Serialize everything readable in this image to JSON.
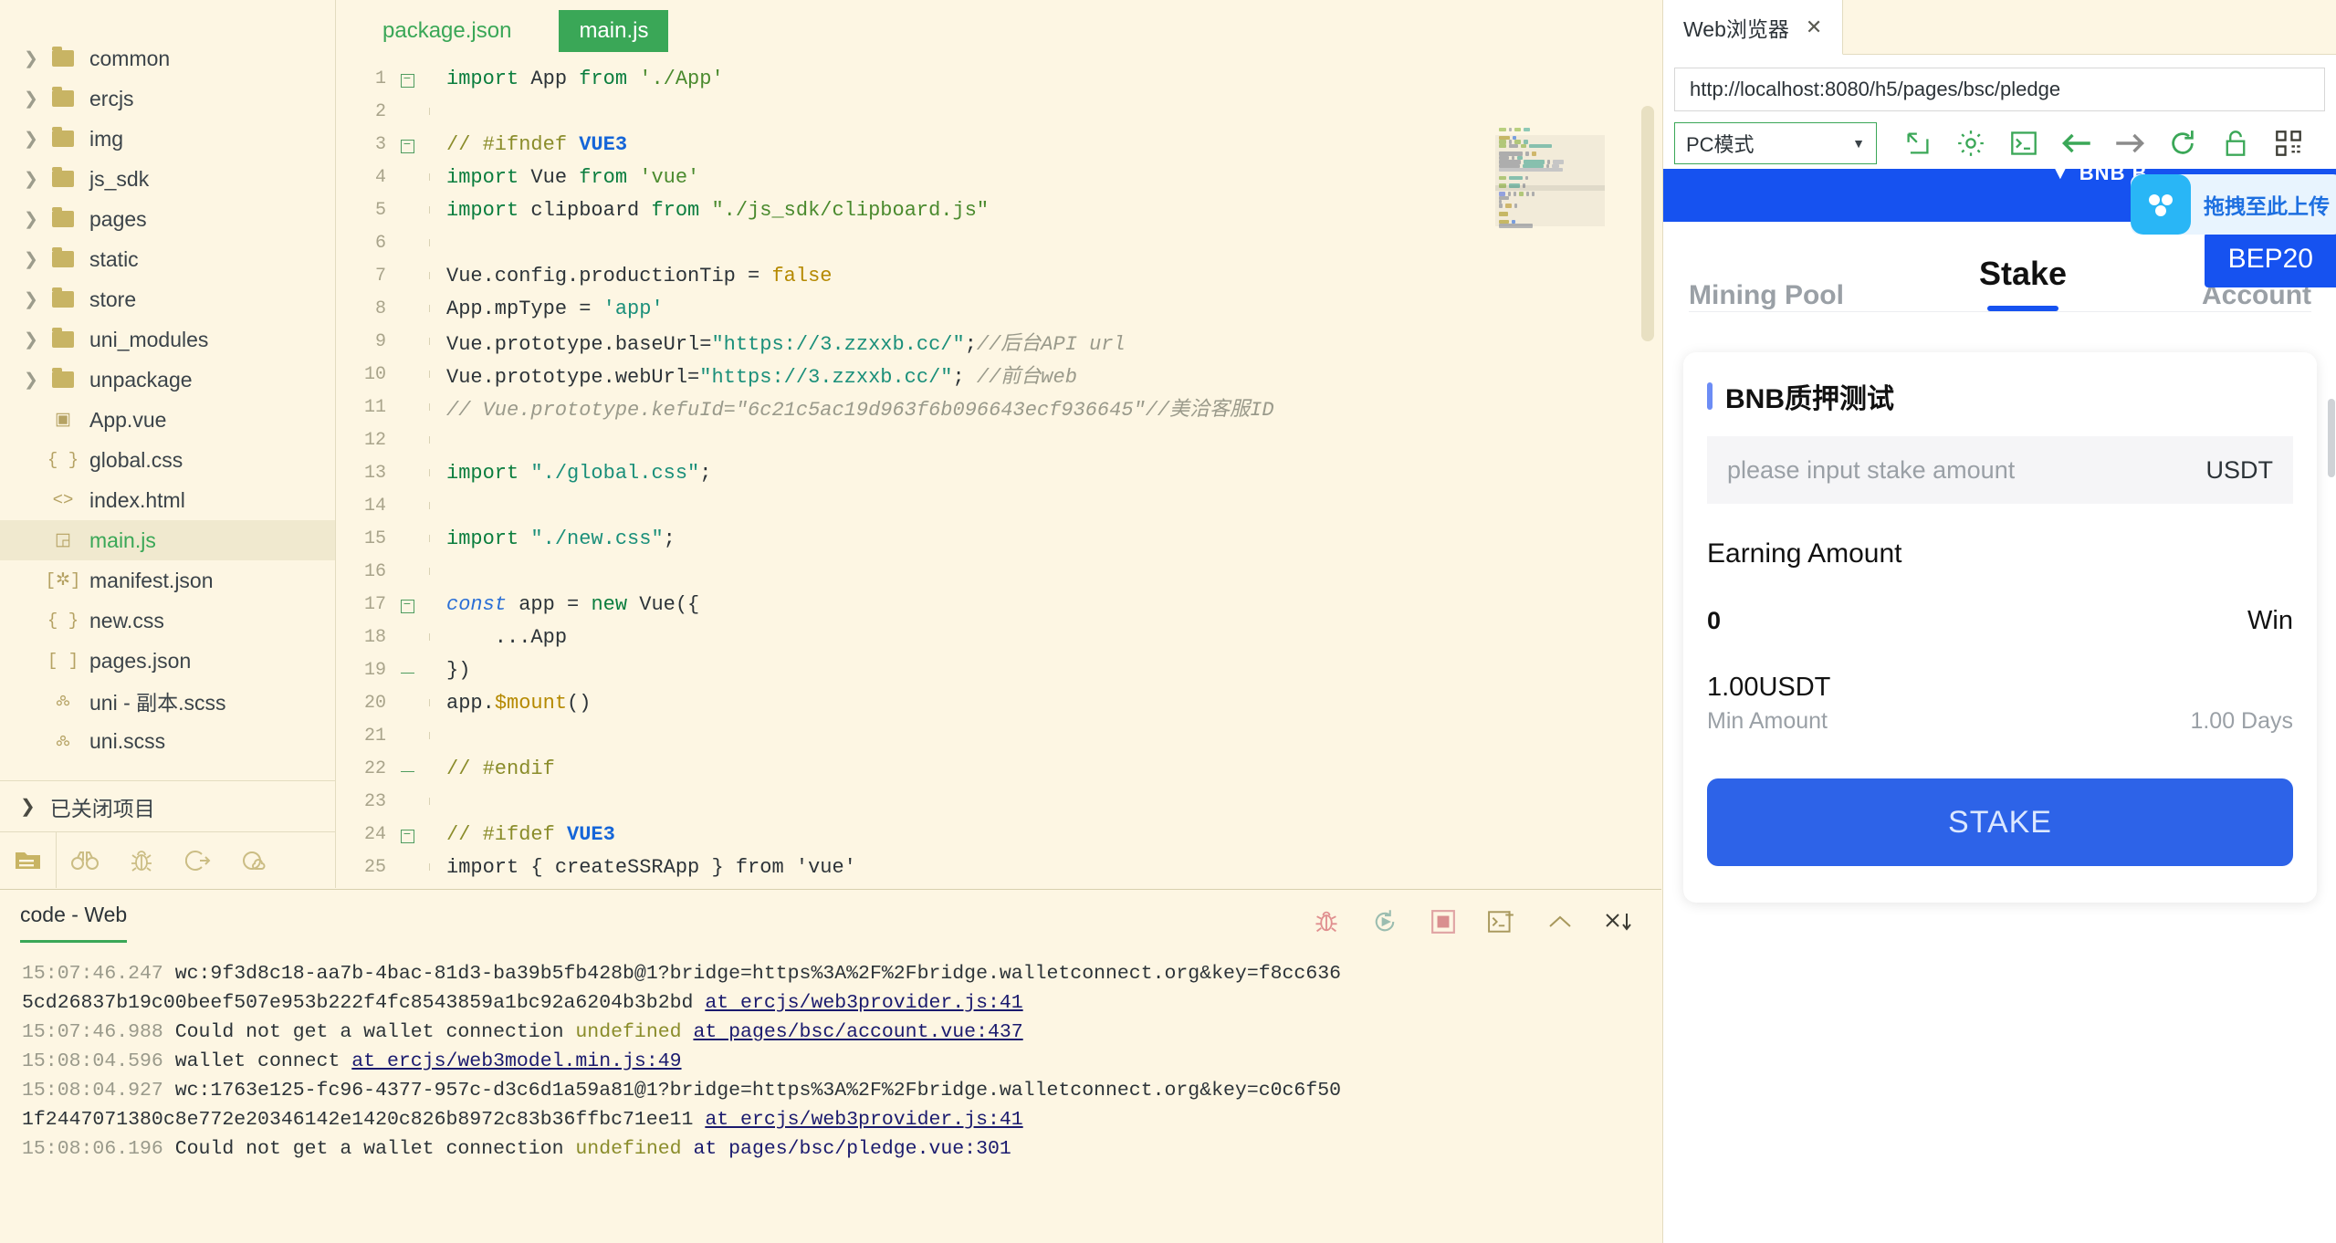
{
  "explorer": {
    "tree": [
      {
        "label": "common",
        "type": "folder",
        "expandable": true
      },
      {
        "label": "ercjs",
        "type": "folder",
        "expandable": true
      },
      {
        "label": "img",
        "type": "folder",
        "expandable": true
      },
      {
        "label": "js_sdk",
        "type": "folder",
        "expandable": true
      },
      {
        "label": "pages",
        "type": "folder",
        "expandable": true
      },
      {
        "label": "static",
        "type": "folder",
        "expandable": true
      },
      {
        "label": "store",
        "type": "folder",
        "expandable": true
      },
      {
        "label": "uni_modules",
        "type": "folder",
        "expandable": true
      },
      {
        "label": "unpackage",
        "type": "folder",
        "expandable": true
      },
      {
        "label": "App.vue",
        "type": "vue",
        "glyph": "▣",
        "expandable": false
      },
      {
        "label": "global.css",
        "type": "css",
        "glyph": "{ }",
        "expandable": false
      },
      {
        "label": "index.html",
        "type": "html",
        "glyph": "<>",
        "expandable": false
      },
      {
        "label": "main.js",
        "type": "js",
        "glyph": "◲",
        "expandable": false,
        "selected": true
      },
      {
        "label": "manifest.json",
        "type": "json",
        "glyph": "[✲]",
        "expandable": false
      },
      {
        "label": "new.css",
        "type": "css",
        "glyph": "{ }",
        "expandable": false
      },
      {
        "label": "pages.json",
        "type": "json",
        "glyph": "[ ]",
        "expandable": false
      },
      {
        "label": "uni - 副本.scss",
        "type": "scss",
        "glyph": "🝆",
        "expandable": false
      },
      {
        "label": "uni.scss",
        "type": "scss",
        "glyph": "🝆",
        "expandable": false
      }
    ],
    "closed_projects_label": "已关闭项目",
    "activity_icons": [
      "files-icon",
      "binoculars-icon",
      "bug-icon",
      "share-icon",
      "cloud-icon"
    ]
  },
  "editor": {
    "tabs": [
      {
        "label": "package.json",
        "active": false
      },
      {
        "label": "main.js",
        "active": true
      }
    ],
    "lines": [
      {
        "n": 1,
        "fold": "open",
        "guide": "none",
        "tokens": [
          {
            "t": "import ",
            "c": "kw"
          },
          {
            "t": "App",
            "c": "id"
          },
          {
            "t": " from ",
            "c": "kw"
          },
          {
            "t": "'./App'",
            "c": "str"
          }
        ]
      },
      {
        "n": 2,
        "fold": "",
        "guide": "bar",
        "tokens": []
      },
      {
        "n": 3,
        "fold": "open",
        "guide": "none",
        "tokens": [
          {
            "t": "// #ifndef ",
            "c": "cmt2"
          },
          {
            "t": "VUE3",
            "c": "blue"
          }
        ]
      },
      {
        "n": 4,
        "fold": "",
        "guide": "bar",
        "tokens": [
          {
            "t": "import ",
            "c": "kw"
          },
          {
            "t": "Vue",
            "c": "id"
          },
          {
            "t": " from ",
            "c": "kw"
          },
          {
            "t": "'vue'",
            "c": "str"
          }
        ]
      },
      {
        "n": 5,
        "fold": "",
        "guide": "bar",
        "tokens": [
          {
            "t": "import ",
            "c": "kw"
          },
          {
            "t": "clipboard",
            "c": "id"
          },
          {
            "t": " from ",
            "c": "kw"
          },
          {
            "t": "\"./js_sdk/clipboard.js\"",
            "c": "str"
          }
        ]
      },
      {
        "n": 6,
        "fold": "",
        "guide": "bar",
        "tokens": []
      },
      {
        "n": 7,
        "fold": "",
        "guide": "bar",
        "tokens": [
          {
            "t": "Vue.config.productionTip",
            "c": "id"
          },
          {
            "t": " = ",
            "c": "punc"
          },
          {
            "t": "false",
            "c": "bool"
          }
        ]
      },
      {
        "n": 8,
        "fold": "",
        "guide": "bar",
        "tokens": [
          {
            "t": "App.mpType",
            "c": "id"
          },
          {
            "t": " = ",
            "c": "punc"
          },
          {
            "t": "'app'",
            "c": "str2"
          }
        ]
      },
      {
        "n": 9,
        "fold": "",
        "guide": "bar",
        "tokens": [
          {
            "t": "Vue.prototype.baseUrl=",
            "c": "id"
          },
          {
            "t": "\"https://3.zzxxb.cc/\"",
            "c": "str2"
          },
          {
            "t": ";",
            "c": "punc"
          },
          {
            "t": "//后台API url",
            "c": "cmt"
          }
        ]
      },
      {
        "n": 10,
        "fold": "",
        "guide": "bar",
        "tokens": [
          {
            "t": "Vue.prototype.webUrl=",
            "c": "id"
          },
          {
            "t": "\"https://3.zzxxb.cc/\"",
            "c": "str2"
          },
          {
            "t": "; ",
            "c": "punc"
          },
          {
            "t": "//前台web",
            "c": "cmt"
          }
        ]
      },
      {
        "n": 11,
        "fold": "",
        "guide": "bar",
        "tokens": [
          {
            "t": "// Vue.prototype.kefuId=\"6c21c5ac19d963f6b096643ecf936645\"//美洽客服ID",
            "c": "cmt"
          }
        ]
      },
      {
        "n": 12,
        "fold": "",
        "guide": "bar",
        "tokens": []
      },
      {
        "n": 13,
        "fold": "",
        "guide": "bar",
        "tokens": [
          {
            "t": "import ",
            "c": "kw"
          },
          {
            "t": "\"./global.css\"",
            "c": "str2"
          },
          {
            "t": ";",
            "c": "punc"
          }
        ]
      },
      {
        "n": 14,
        "fold": "",
        "guide": "bar",
        "tokens": []
      },
      {
        "n": 15,
        "fold": "",
        "guide": "bar",
        "tokens": [
          {
            "t": "import ",
            "c": "kw"
          },
          {
            "t": "\"./new.css\"",
            "c": "str2"
          },
          {
            "t": ";",
            "c": "punc"
          }
        ]
      },
      {
        "n": 16,
        "fold": "",
        "guide": "bar",
        "tokens": []
      },
      {
        "n": 17,
        "fold": "open",
        "guide": "none",
        "tokens": [
          {
            "t": "const ",
            "c": "kw2"
          },
          {
            "t": "app",
            "c": "id"
          },
          {
            "t": " = ",
            "c": "punc"
          },
          {
            "t": "new ",
            "c": "kw"
          },
          {
            "t": "Vue",
            "c": "id"
          },
          {
            "t": "({",
            "c": "punc"
          }
        ]
      },
      {
        "n": 18,
        "fold": "",
        "guide": "bar",
        "tokens": [
          {
            "t": "    ...App",
            "c": "id"
          }
        ]
      },
      {
        "n": 19,
        "fold": "end",
        "guide": "none",
        "tokens": [
          {
            "t": "})",
            "c": "punc"
          }
        ]
      },
      {
        "n": 20,
        "fold": "",
        "guide": "bar",
        "tokens": [
          {
            "t": "app.",
            "c": "id"
          },
          {
            "t": "$mount",
            "c": "num"
          },
          {
            "t": "()",
            "c": "punc"
          }
        ]
      },
      {
        "n": 21,
        "fold": "",
        "guide": "bar",
        "tokens": []
      },
      {
        "n": 22,
        "fold": "end",
        "guide": "none",
        "tokens": [
          {
            "t": "// #endif",
            "c": "cmt2"
          }
        ]
      },
      {
        "n": 23,
        "fold": "",
        "guide": "bar",
        "tokens": []
      },
      {
        "n": 24,
        "fold": "open",
        "guide": "none",
        "tokens": [
          {
            "t": "// #ifdef ",
            "c": "cmt2"
          },
          {
            "t": "VUE3",
            "c": "blue"
          }
        ]
      },
      {
        "n": 25,
        "fold": "",
        "guide": "bar",
        "tokens": [
          {
            "t": "import { createSSRApp } from 'vue'",
            "c": "id"
          }
        ]
      }
    ]
  },
  "console": {
    "tab_label": "code - Web",
    "tools": [
      "bug-icon",
      "rerun-icon",
      "stop-icon",
      "new-terminal-icon",
      "collapse-icon",
      "clear-icon"
    ],
    "entries": [
      {
        "time": "15:07:46.247",
        "text": " wc:9f3d8c18-aa7b-4bac-81d3-ba39b5fb428b@1?bridge=https%3A%2F%2Fbridge.walletconnect.org&key=f8cc636",
        "undef": "",
        "link": "",
        "link_underlined": false
      },
      {
        "time": "",
        "text": "5cd26837b19c00beef507e953b222f4fc8543859a1bc92a6204b3b2bd ",
        "undef": "",
        "link": "at ercjs/web3provider.js:41",
        "link_underlined": true
      },
      {
        "time": "15:07:46.988",
        "text": " Could not get a wallet connection ",
        "undef": "undefined",
        "link": "at pages/bsc/account.vue:437",
        "link_underlined": true
      },
      {
        "time": "15:08:04.596",
        "text": " wallet connect ",
        "undef": "",
        "link": "at ercjs/web3model.min.js:49",
        "link_underlined": true
      },
      {
        "time": "15:08:04.927",
        "text": " wc:1763e125-fc96-4377-957c-d3c6d1a59a81@1?bridge=https%3A%2F%2Fbridge.walletconnect.org&key=c0c6f50",
        "undef": "",
        "link": "",
        "link_underlined": false
      },
      {
        "time": "",
        "text": "1f2447071380c8e772e20346142e1420c826b8972c83b36ffbc71ee11 ",
        "undef": "",
        "link": "at ercjs/web3provider.js:41",
        "link_underlined": true
      },
      {
        "time": "15:08:06.196",
        "text": " Could not get a wallet connection ",
        "undef": "undefined",
        "link": "at pages/bsc/pledge.vue:301",
        "link_underlined": false
      }
    ]
  },
  "browser": {
    "tab_label": "Web浏览器",
    "tab_close": "✕",
    "url": "http://localhost:8080/h5/pages/bsc/pledge",
    "mode_select": "PC模式",
    "toolbar_icons": [
      "popout-icon",
      "gear-icon",
      "console-icon",
      "back-arrow-icon",
      "forward-arrow-icon",
      "reload-icon",
      "lock-icon",
      "qrcode-icon"
    ]
  },
  "preview": {
    "status_title": "BNB B",
    "drag_tooltip": "拖拽至此上传",
    "network_badge": "BEP20",
    "tabs": [
      {
        "label": "Mining Pool",
        "active": false
      },
      {
        "label": "Stake",
        "active": true
      },
      {
        "label": "Account",
        "active": false
      }
    ],
    "card": {
      "title": "BNB质押测试",
      "input_placeholder": "please input stake amount",
      "input_unit": "USDT",
      "earning_label": "Earning Amount",
      "earning_value": "0",
      "earning_unit": "Win",
      "min_amount_value": "1.00USDT",
      "min_amount_label": "Min Amount",
      "days_value": "1.00 Days",
      "stake_button": "STAKE"
    }
  },
  "colors": {
    "accent_green": "#3aa757",
    "brand_blue": "#1652f0",
    "button_blue": "#2d63e8",
    "editor_bg": "#fdf6e3"
  }
}
